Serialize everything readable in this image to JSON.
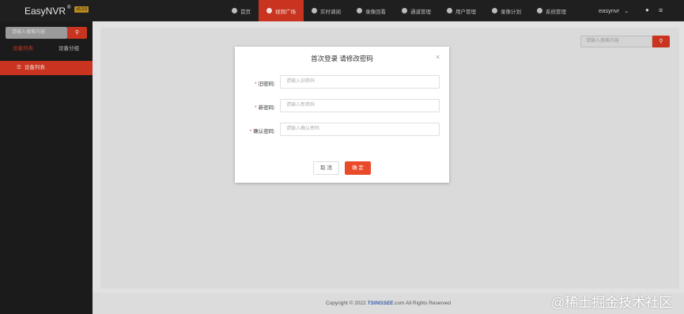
{
  "app": {
    "name": "EasyNVR",
    "registered": "®",
    "version": "v5.3.5"
  },
  "nav": {
    "items": [
      {
        "label": "首页",
        "icon": "dashboard-icon"
      },
      {
        "label": "视频广场",
        "icon": "play-circle-icon",
        "active": true
      },
      {
        "label": "实时调阅",
        "icon": "video-icon"
      },
      {
        "label": "录像回看",
        "icon": "film-icon"
      },
      {
        "label": "通道管理",
        "icon": "grid-icon"
      },
      {
        "label": "用户管理",
        "icon": "user-icon"
      },
      {
        "label": "录像计划",
        "icon": "compass-icon"
      },
      {
        "label": "系统管理",
        "icon": "gear-icon"
      }
    ],
    "user": "easynvr"
  },
  "sidebar": {
    "search_placeholder": "请输入搜索内容",
    "tabs": [
      "设备列表",
      "设备分组"
    ],
    "item": "设备列表"
  },
  "main": {
    "search_placeholder": "请输入搜索内容"
  },
  "dialog": {
    "title": "首次登录 请修改密码",
    "fields": [
      {
        "label": "旧密码:",
        "placeholder": "请输入旧密码"
      },
      {
        "label": "新密码:",
        "placeholder": "请输入新密码"
      },
      {
        "label": "确认密码:",
        "placeholder": "请输入确认密码"
      }
    ],
    "cancel_label": "取 消",
    "ok_label": "确 定"
  },
  "footer": {
    "prefix": "Copyright © 2022 ",
    "brand": "TSINGSEE",
    "suffix": ".com All Rights Reserved"
  },
  "watermark": "@稀土掘金技术社区",
  "colors": {
    "accent": "#c8341f",
    "topbar": "#1f1f1f",
    "primary_button": "#e84a2a"
  }
}
